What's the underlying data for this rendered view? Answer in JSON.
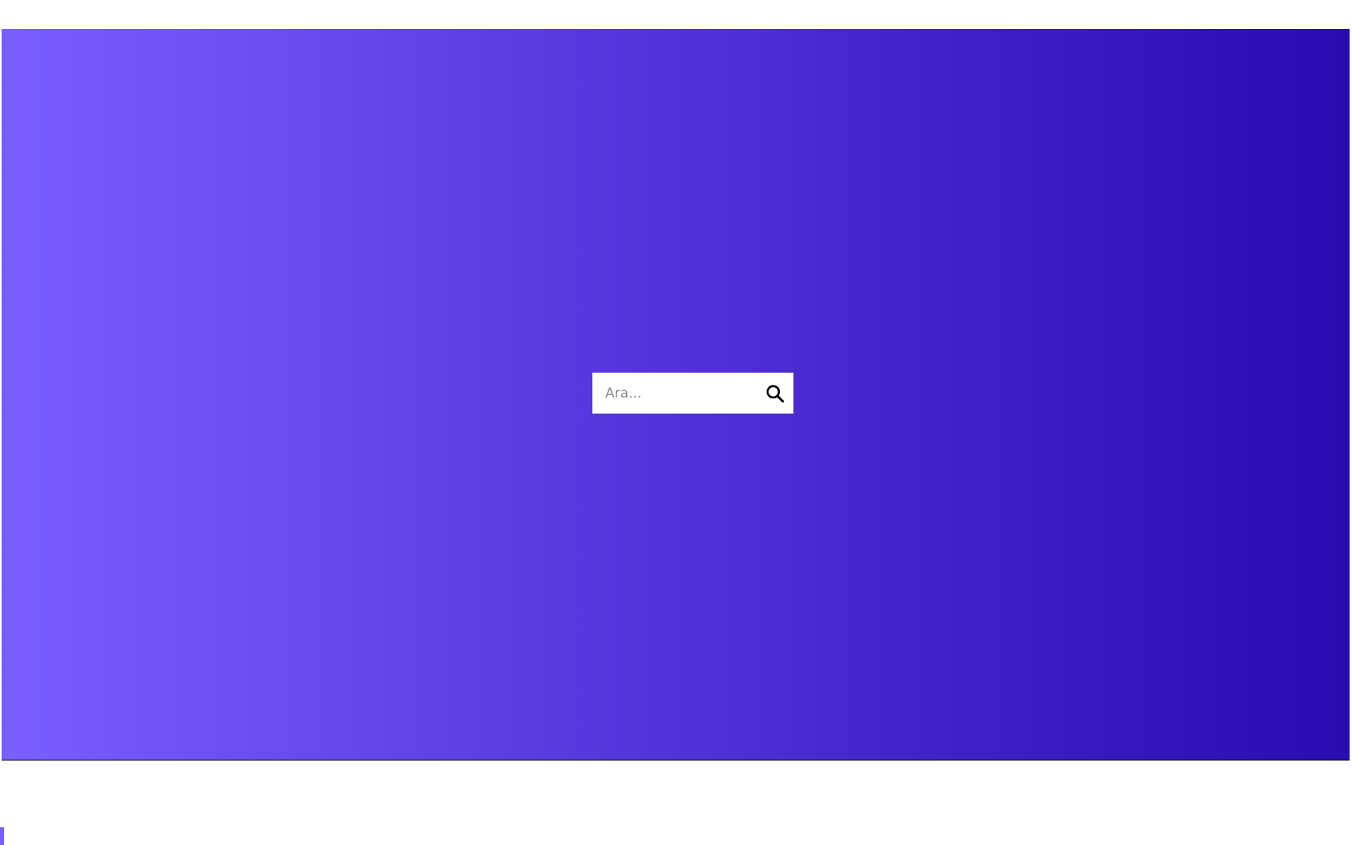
{
  "search": {
    "placeholder": "Ara...",
    "value": "",
    "icon": "search-icon"
  },
  "hero": {
    "gradient_start": "#7b5eff",
    "gradient_end": "#2a0bb0"
  }
}
